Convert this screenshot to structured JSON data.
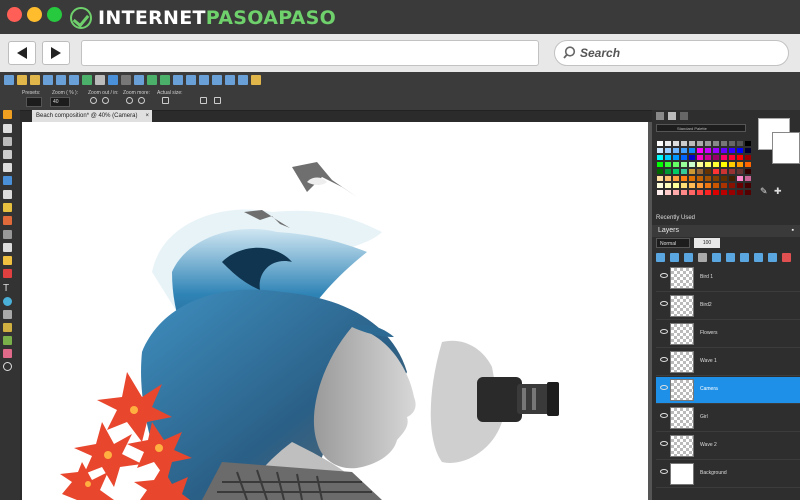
{
  "browser": {
    "logo_text": "INTERNETPASOAPASO",
    "search_placeholder": "Search",
    "traffic_colors": [
      "#ff5f56",
      "#ffbd2e",
      "#27c93f"
    ]
  },
  "app": {
    "options": {
      "presets_label": "Presets:",
      "zoom_label": "Zoom ( % ):",
      "zoom_value": "40",
      "zoom_out_label": "Zoom out / in:",
      "zoom_more_label": "Zoom more:",
      "actual_size_label": "Actual size:"
    },
    "document_tab": "Beach composition* @ 40% (Camera)",
    "document_close": "×",
    "palette_name": "Standard Palette",
    "recently_used": "Recently Used",
    "layers_title": "Layers",
    "blend_mode": "Normal",
    "opacity": "100",
    "layers": [
      {
        "name": "Bird 1",
        "selected": false
      },
      {
        "name": "Bird2",
        "selected": false
      },
      {
        "name": "Flowers",
        "selected": false
      },
      {
        "name": "Wave 1",
        "selected": false
      },
      {
        "name": "Camera",
        "selected": true
      },
      {
        "name": "Girl",
        "selected": false
      },
      {
        "name": "Wave 2",
        "selected": false
      },
      {
        "name": "Background",
        "selected": false
      }
    ],
    "accent": "#1e90e8"
  }
}
